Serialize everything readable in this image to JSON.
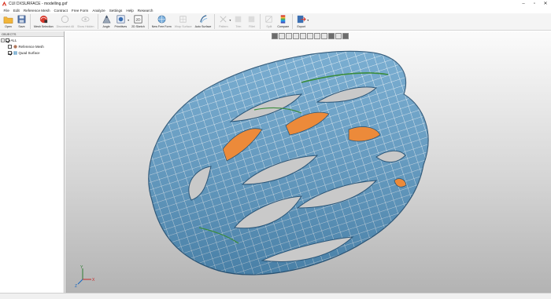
{
  "window": {
    "title": "CUI DXSURFACE - modelling.gxf"
  },
  "menu": [
    "File",
    "Edit",
    "Reference Mesh",
    "Contract",
    "Free Form",
    "Analyze",
    "Settings",
    "Help",
    "Research"
  ],
  "toolbar": {
    "open": "Open",
    "save": "Save",
    "mesh_selection": "Mesh Selection",
    "disconnect_all": "Disconnect All",
    "show_hidden": "Show Hidden",
    "angle": "Angle",
    "primitives": "Primitives",
    "sketch_2d": "2D Sketch",
    "new_free_form": "New Free Form",
    "wrap_surface": "Wrap Surface",
    "auto_surface": "Auto Surface",
    "pattern": "Pattern",
    "trim": "Trim",
    "fillet": "Fillet",
    "split": "Split",
    "compare": "Compare",
    "export": "Export",
    "sketch_icon_text": "2D"
  },
  "objects_panel": {
    "header": "OBJECTS",
    "root_label": "ALL",
    "items": [
      {
        "label": "Reference Mesh",
        "checked": false
      },
      {
        "label": "Quad Surface",
        "checked": true
      }
    ]
  },
  "axes": {
    "x": "X",
    "y": "Y",
    "z": "Z"
  },
  "colors": {
    "surface": "#5d9cc7",
    "surface_lines": "#ffffff",
    "inner_orange": "#ec8a3a",
    "accent_green": "#3a8c3a",
    "background_top": "#fbfbfb",
    "background_bottom": "#b3b3b3"
  }
}
